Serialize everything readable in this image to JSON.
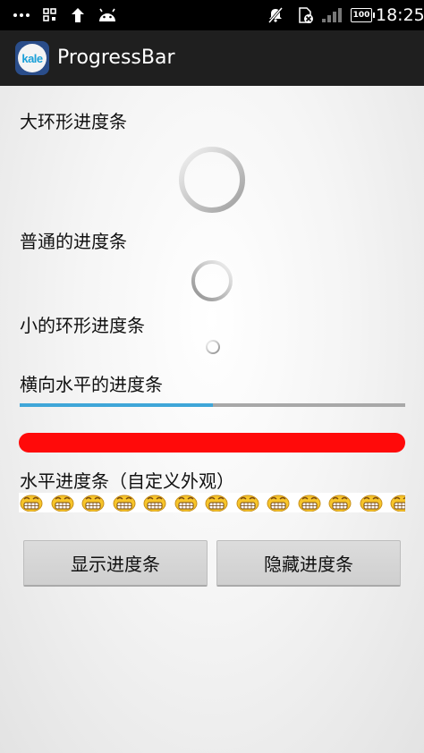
{
  "status_bar": {
    "time": "18:25",
    "battery": "100",
    "icons": [
      "more-dots-icon",
      "grid-icon",
      "upload-arrow-icon",
      "android-icon",
      "mute-icon",
      "sim-blocked-icon",
      "signal-icon",
      "battery-icon"
    ]
  },
  "action_bar": {
    "title": "ProgressBar",
    "app_icon_text": "kale"
  },
  "labels": {
    "large_spinner": "大环形进度条",
    "normal_spinner": "普通的进度条",
    "small_spinner": "小的环形进度条",
    "horizontal_bar": "横向水平的进度条",
    "custom_bar": "水平进度条（自定义外观）"
  },
  "progress": {
    "horizontal_fraction": 0.5,
    "red_bar_fraction": 1.0,
    "emoji_count": 13
  },
  "colors": {
    "progress_blue": "#3fa6d8",
    "track_gray": "#a8a8a8",
    "red_bar": "#ff0a0a",
    "emoji_yellow": "#f7c52a"
  },
  "buttons": {
    "show": "显示进度条",
    "hide": "隐藏进度条"
  }
}
